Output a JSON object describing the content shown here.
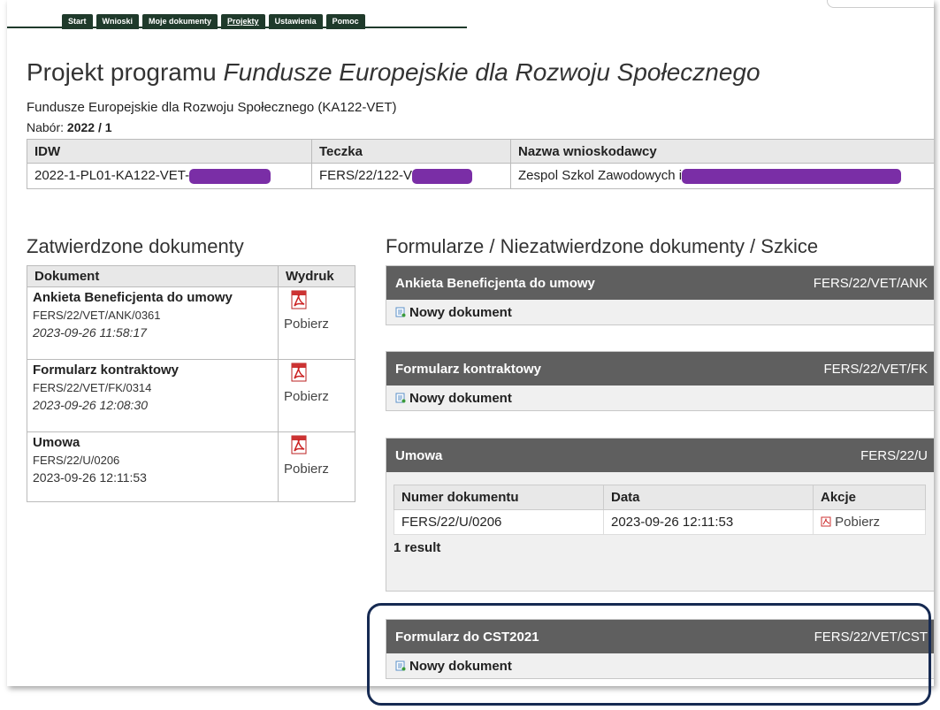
{
  "tabs": [
    "Start",
    "Wnioski",
    "Moje dokumenty",
    "Projekty",
    "Ustawienia",
    "Pomoc"
  ],
  "active_tab": "Projekty",
  "page": {
    "title_prefix": "Projekt programu ",
    "title_italic": "Fundusze Europejskie dla Rozwoju Społecznego",
    "subtitle": "Fundusze Europejskie dla Rozwoju Społecznego (KA122-VET)",
    "nabor_label": "Nabór: ",
    "nabor_value": "2022 / 1"
  },
  "info_table": {
    "headers": [
      "IDW",
      "Teczka",
      "Nazwa wnioskodawcy"
    ],
    "row": [
      "2022-1-PL01-KA122-VET-",
      "FERS/22/122-V",
      "Zespol Szkol Zawodowych i"
    ]
  },
  "approved": {
    "heading": "Zatwierdzone dokumenty",
    "headers": [
      "Dokument",
      "Wydruk"
    ],
    "rows": [
      {
        "name": "Ankieta Beneficjenta do umowy",
        "number": "FERS/22/VET/ANK/0361",
        "date": "2023-09-26 11:58:17",
        "date_italic": true,
        "action": "Pobierz"
      },
      {
        "name": "Formularz kontraktowy",
        "number": "FERS/22/VET/FK/0314",
        "date": "2023-09-26 12:08:30",
        "date_italic": true,
        "action": "Pobierz"
      },
      {
        "name": "Umowa",
        "number": "FERS/22/U/0206",
        "date": "2023-09-26 12:11:53",
        "date_italic": false,
        "action": "Pobierz"
      }
    ]
  },
  "forms": {
    "heading": "Formularze / Niezatwierdzone dokumenty / Szkice",
    "new_doc_label": "Nowy dokument",
    "panels": [
      {
        "title": "Ankieta Beneficjenta do umowy",
        "code": "FERS/22/VET/ANK"
      },
      {
        "title": "Formularz kontraktowy",
        "code": "FERS/22/VET/FK"
      },
      {
        "title": "Umowa",
        "code": "FERS/22/U"
      },
      {
        "title": "Formularz do CST2021",
        "code": "FERS/22/VET/CST"
      }
    ],
    "umowa_table": {
      "headers": [
        "Numer dokumentu",
        "Data",
        "Akcje"
      ],
      "row": [
        "FERS/22/U/0206",
        "2023-09-26 12:11:53",
        "Pobierz"
      ],
      "result": "1 result"
    }
  },
  "colors": {
    "tab_bg": "#1f3a2b",
    "panel_head": "#5f5f5f",
    "redaction": "#7a2ea6",
    "highlight_border": "#162a52"
  }
}
